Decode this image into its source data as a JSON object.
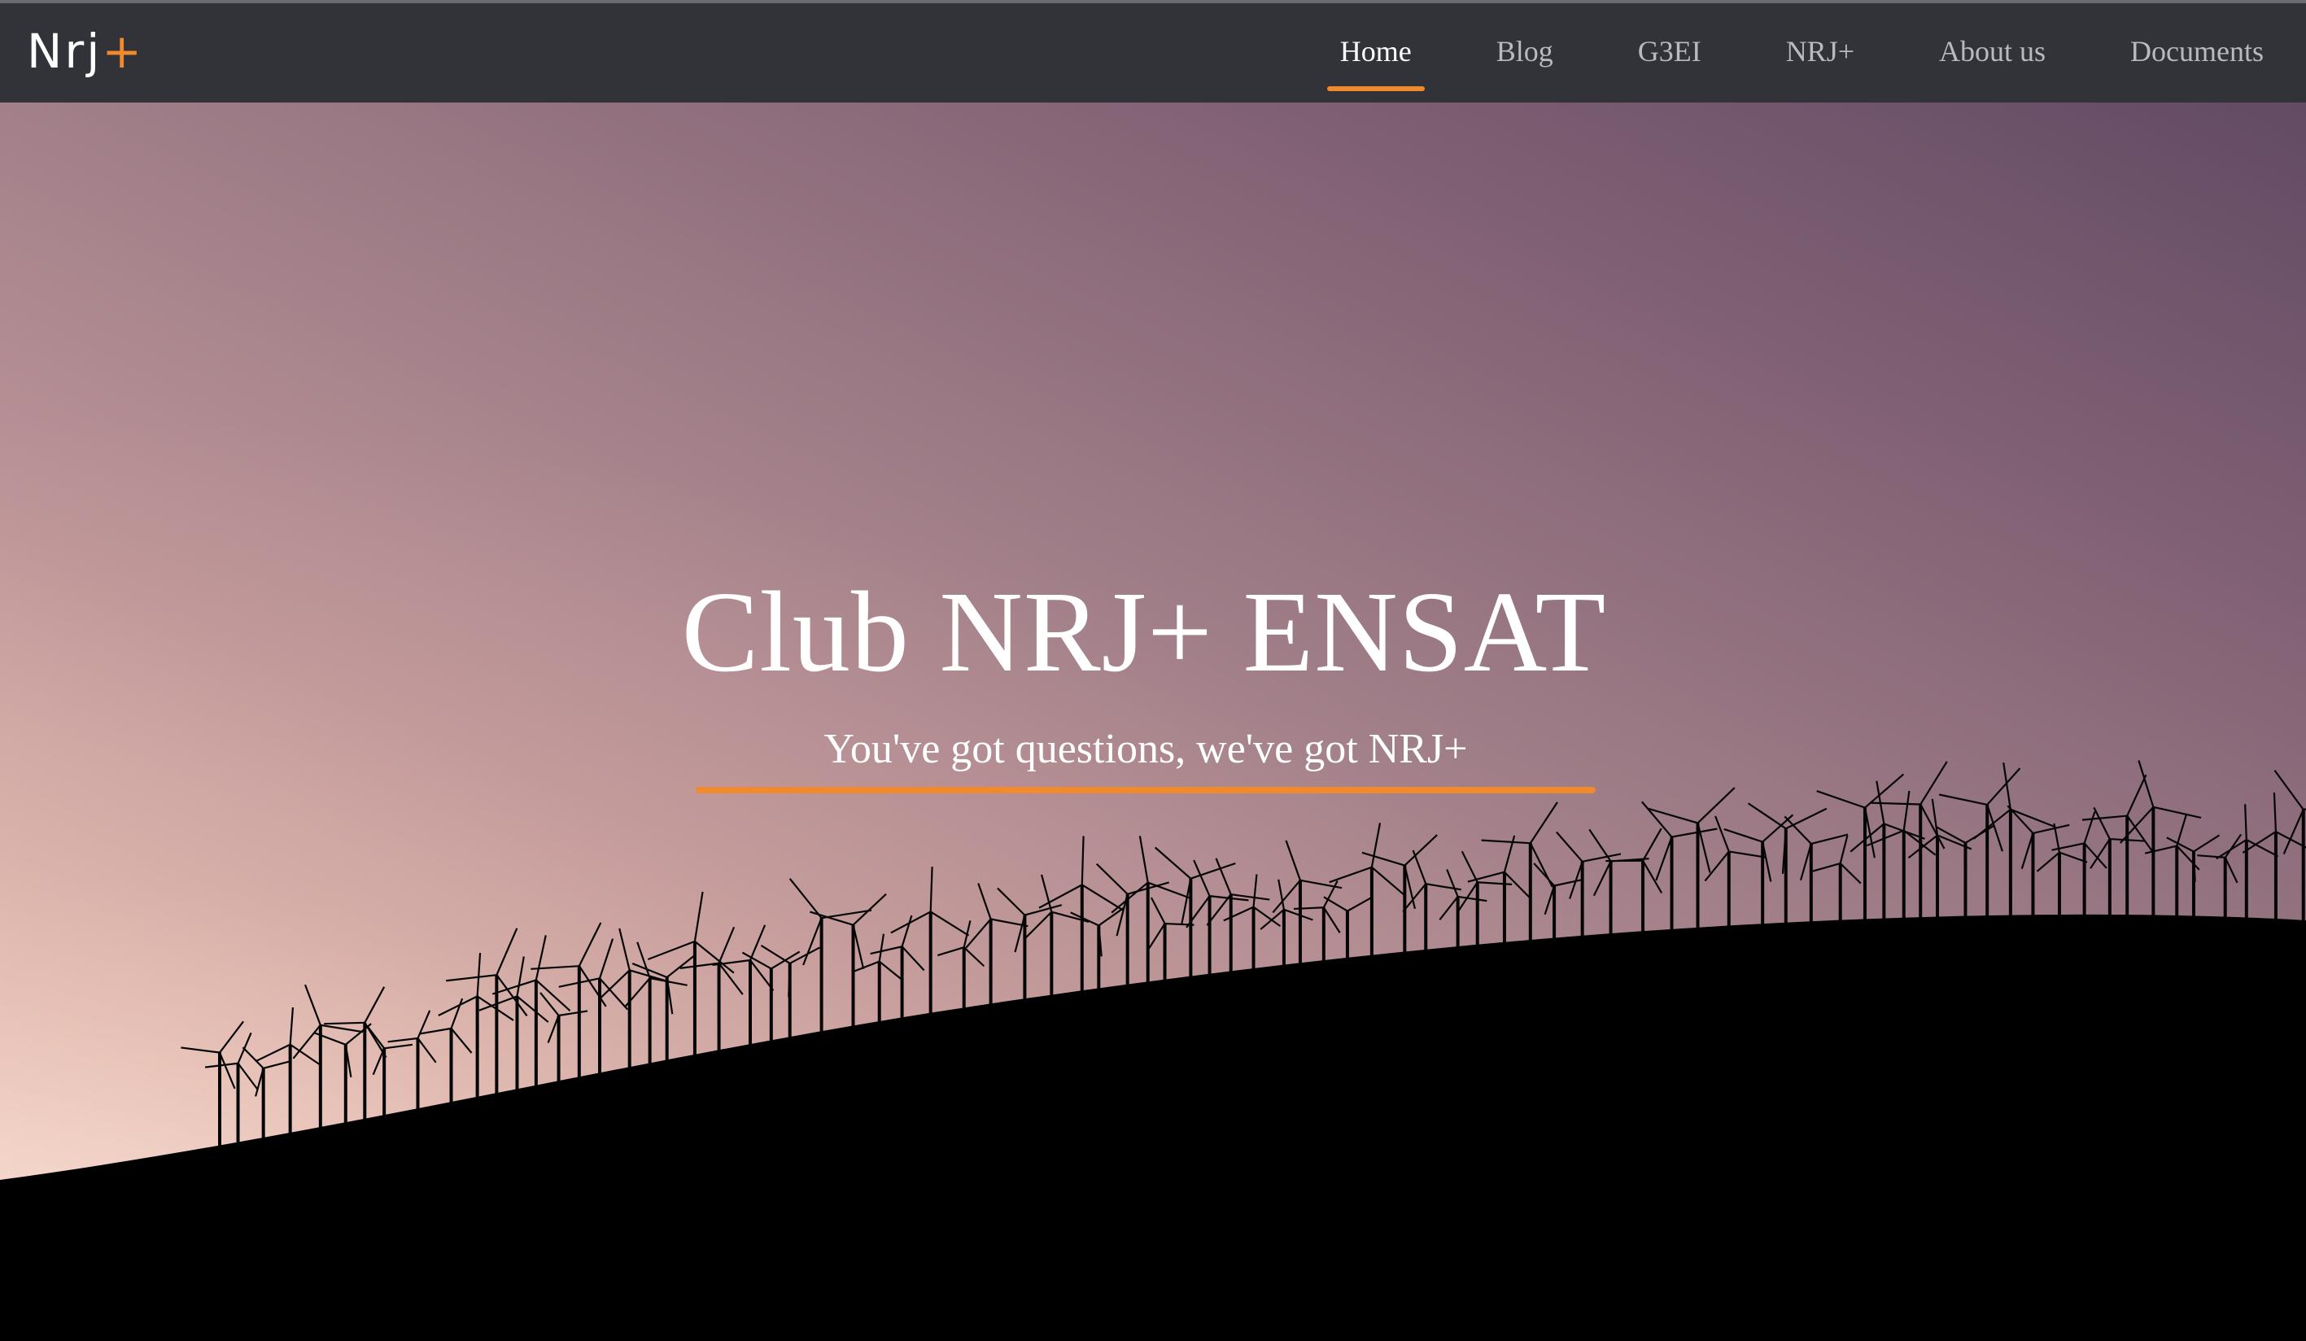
{
  "navbar": {
    "brand": {
      "text": "Nrj",
      "accent": "+"
    },
    "items": [
      {
        "label": "Home",
        "active": true
      },
      {
        "label": "Blog",
        "active": false
      },
      {
        "label": "G3EI",
        "active": false
      },
      {
        "label": "NRJ+",
        "active": false
      },
      {
        "label": "About us",
        "active": false
      },
      {
        "label": "Documents",
        "active": false
      }
    ]
  },
  "hero": {
    "title": "Club NRJ+ ENSAT",
    "subtitle": "You've got questions, we've got NRJ+",
    "background_image": "wind-turbines-silhouette-at-dusk"
  },
  "colors": {
    "navbar_bg": "#323338",
    "accent": "#f08a2c",
    "nav_text": "#b9babf",
    "nav_text_active": "#ffffff"
  }
}
